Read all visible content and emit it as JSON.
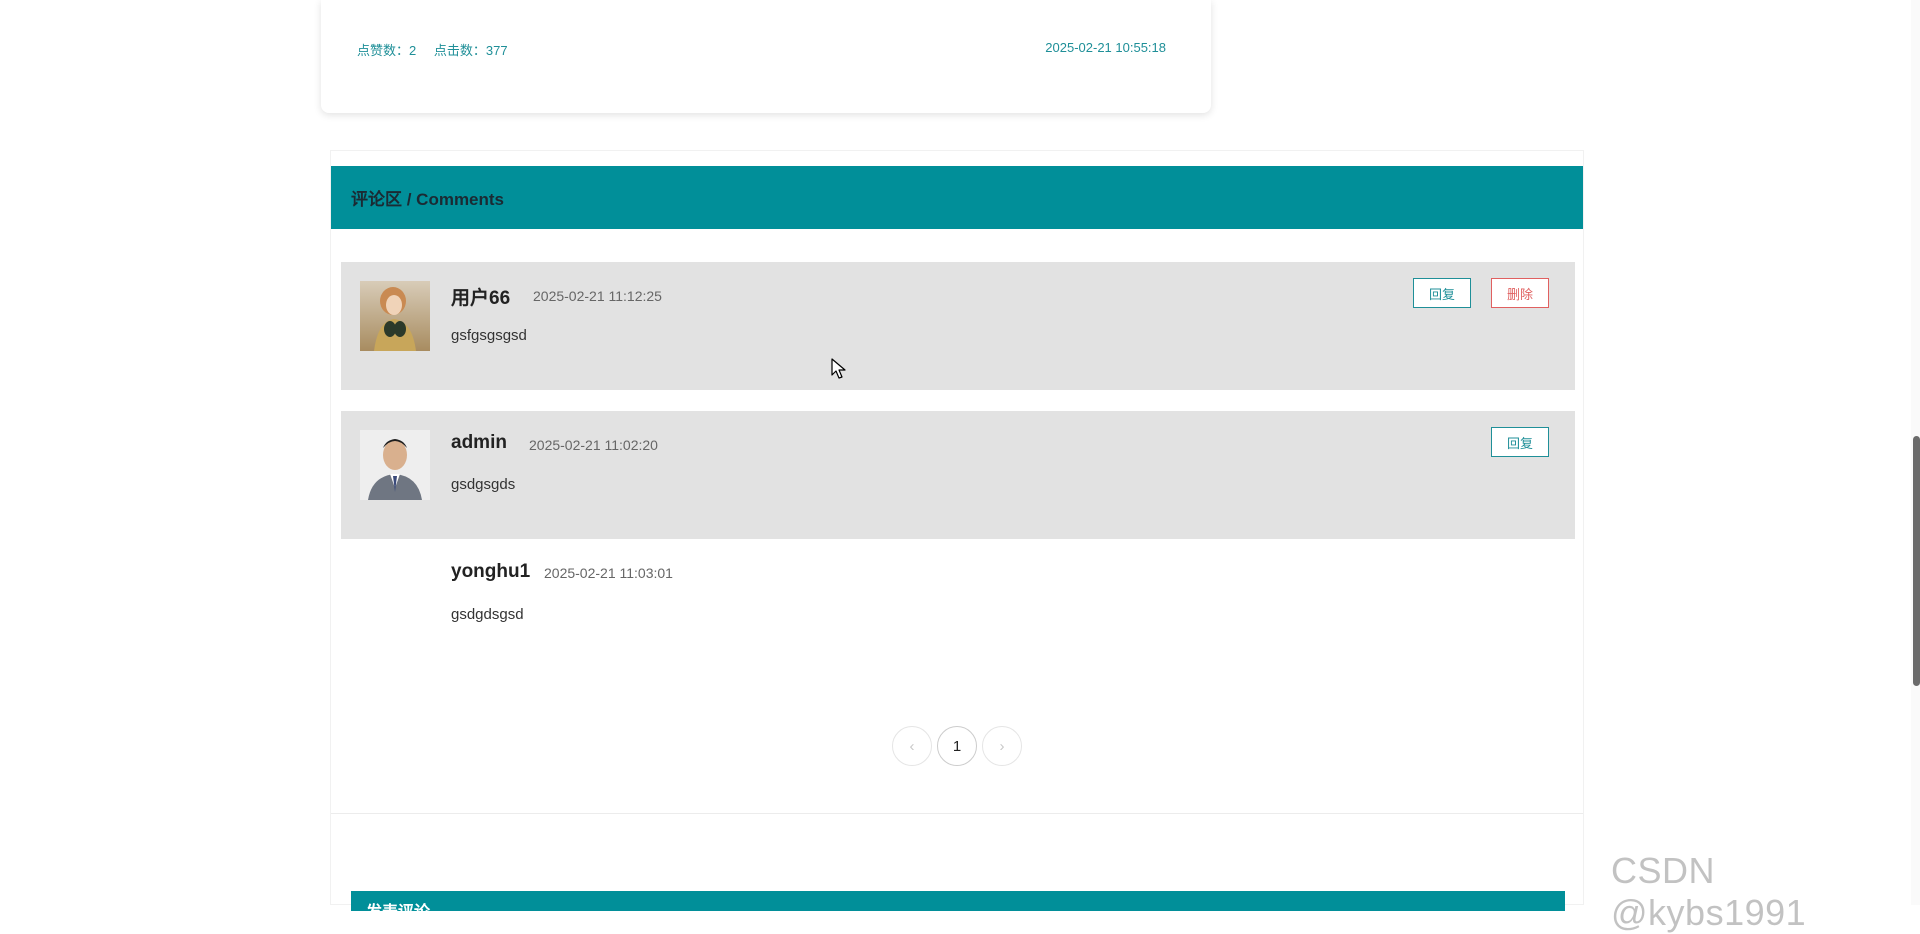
{
  "article": {
    "likes_label": "点赞数：2",
    "clicks_label": "点击数：377",
    "date": "2025-02-21 10:55:18"
  },
  "comments_section": {
    "title": "评论区 / Comments",
    "comments": [
      {
        "user": "用户66",
        "time": "2025-02-21 11:12:25",
        "text": "gsfgsgsgsd",
        "reply_label": "回复",
        "delete_label": "删除",
        "avatar_icon": "portrait-illustration-avatar"
      },
      {
        "user": "admin",
        "time": "2025-02-21 11:02:20",
        "text": "gsdgsgds",
        "reply_label": "回复",
        "avatar_icon": "business-man-avatar"
      }
    ],
    "reply": {
      "user": "yonghu1",
      "time": "2025-02-21 11:03:01",
      "text": "gsdgdsgsd"
    },
    "pagination": {
      "prev": "‹",
      "current": "1",
      "next": "›"
    }
  },
  "post_comment": {
    "title": "发表评论"
  },
  "watermark": "CSDN @kybs1991",
  "colors": {
    "accent": "#018f99",
    "comment_bg": "#e2e2e2",
    "delete": "#e06060"
  }
}
